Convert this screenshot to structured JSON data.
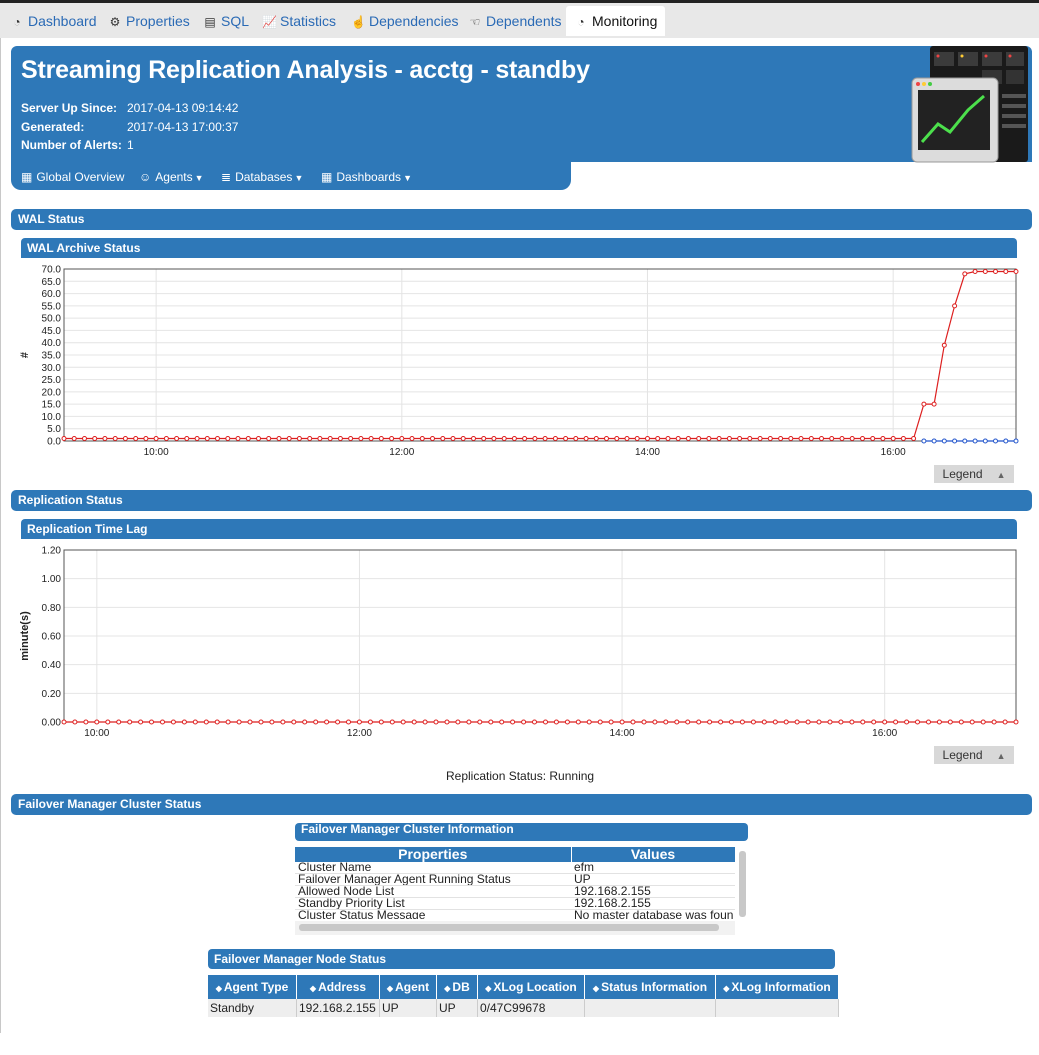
{
  "tabs": [
    {
      "label": "Dashboard",
      "icon": "gauge-icon"
    },
    {
      "label": "Properties",
      "icon": "gears-icon"
    },
    {
      "label": "SQL",
      "icon": "document-icon"
    },
    {
      "label": "Statistics",
      "icon": "line-chart-icon"
    },
    {
      "label": "Dependencies",
      "icon": "hand-pointer-icon"
    },
    {
      "label": "Dependents",
      "icon": "hand-pointer-icon"
    },
    {
      "label": "Monitoring",
      "icon": "gauge-icon"
    }
  ],
  "header": {
    "title": "Streaming Replication Analysis - acctg - standby",
    "server_up_label": "Server Up Since:",
    "server_up_value": "2017-04-13 09:14:42",
    "generated_label": "Generated:",
    "generated_value": "2017-04-13 17:00:37",
    "alerts_label": "Number of Alerts:",
    "alerts_value": "1",
    "nav": [
      "Global Overview",
      "Agents",
      "Databases",
      "Dashboards"
    ]
  },
  "wal": {
    "section_title": "WAL Status",
    "chart_title": "WAL Archive Status",
    "legend_label": "Legend"
  },
  "replication": {
    "section_title": "Replication Status",
    "chart_title": "Replication Time Lag",
    "legend_label": "Legend",
    "status_text": "Replication Status: Running"
  },
  "failover": {
    "section_title": "Failover Manager Cluster Status",
    "cluster_info_title": "Failover Manager Cluster Information",
    "cluster_headers": [
      "Properties",
      "Values"
    ],
    "cluster_rows": [
      [
        "Cluster Name",
        "efm"
      ],
      [
        "Failover Manager Agent Running Status",
        "UP"
      ],
      [
        "Allowed Node List",
        "192.168.2.155"
      ],
      [
        "Standby Priority List",
        "192.168.2.155"
      ],
      [
        "Cluster Status Message",
        "No master database was foun"
      ]
    ],
    "node_status_title": "Failover Manager Node Status",
    "node_headers": [
      "Agent Type",
      "Address",
      "Agent",
      "DB",
      "XLog Location",
      "Status Information",
      "XLog Information"
    ],
    "node_rows": [
      [
        "Standby",
        "192.168.2.155",
        "UP",
        "UP",
        "0/47C99678",
        "",
        ""
      ]
    ]
  },
  "colors": {
    "accent": "#2e78b8",
    "series_red": "#dd1f1f",
    "series_blue": "#2255cc"
  },
  "chart_data": [
    {
      "type": "line",
      "title": "WAL Archive Status",
      "ylabel": "#",
      "xlabel": "",
      "ylim": [
        0,
        70
      ],
      "yticks": [
        "0.0",
        "5.0",
        "10.0",
        "15.0",
        "20.0",
        "25.0",
        "30.0",
        "35.0",
        "40.0",
        "45.0",
        "50.0",
        "55.0",
        "60.0",
        "65.0",
        "70.0"
      ],
      "xlim": [
        "09:15",
        "17:00"
      ],
      "xticks": [
        "10:00",
        "12:00",
        "14:00",
        "16:00"
      ],
      "grid": true,
      "series": [
        {
          "color": "#dd1f1f",
          "points": [
            [
              "09:15",
              1
            ],
            [
              "16:10",
              1
            ],
            [
              "16:15",
              15
            ],
            [
              "16:20",
              15
            ],
            [
              "16:25",
              39
            ],
            [
              "16:30",
              55
            ],
            [
              "16:35",
              68
            ],
            [
              "16:40",
              69
            ],
            [
              "17:00",
              69
            ]
          ]
        },
        {
          "color": "#2255cc",
          "points": [
            [
              "16:15",
              0
            ],
            [
              "17:00",
              0
            ]
          ]
        }
      ]
    },
    {
      "type": "line",
      "title": "Replication Time Lag",
      "ylabel": "minute(s)",
      "xlabel": "",
      "ylim": [
        0,
        1.2
      ],
      "yticks": [
        "0.00",
        "0.20",
        "0.40",
        "0.60",
        "0.80",
        "1.00",
        "1.20"
      ],
      "xlim": [
        "09:45",
        "17:00"
      ],
      "xticks": [
        "10:00",
        "12:00",
        "14:00",
        "16:00"
      ],
      "grid": true,
      "series": [
        {
          "color": "#dd1f1f",
          "points": [
            [
              "09:45",
              0
            ],
            [
              "17:00",
              0
            ]
          ]
        }
      ]
    }
  ]
}
